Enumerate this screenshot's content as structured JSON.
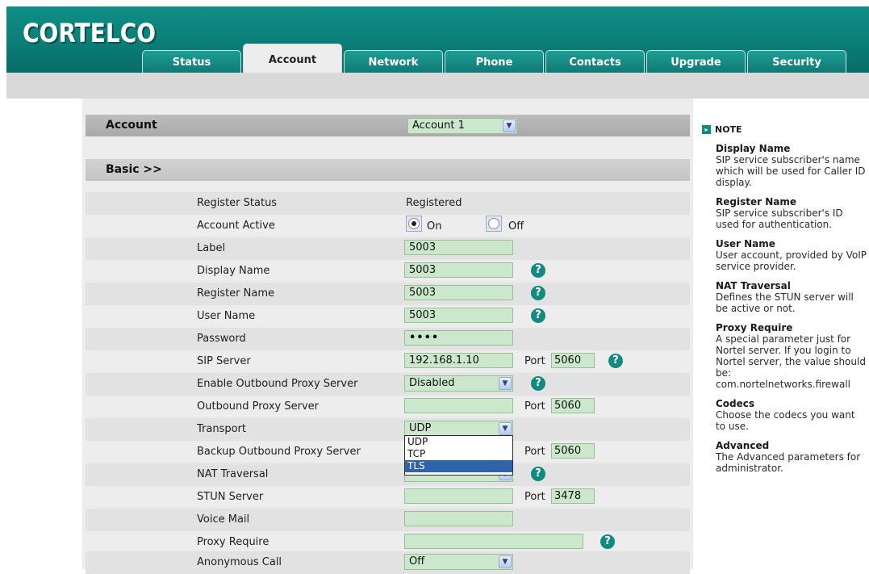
{
  "brand": {
    "logo_text": "CORTELCO"
  },
  "tabs": [
    {
      "label": "Status"
    },
    {
      "label": "Account"
    },
    {
      "label": "Network"
    },
    {
      "label": "Phone"
    },
    {
      "label": "Contacts"
    },
    {
      "label": "Upgrade"
    },
    {
      "label": "Security"
    }
  ],
  "account_bar": {
    "label": "Account",
    "selected": "Account 1"
  },
  "basic_bar": {
    "label": "Basic >>"
  },
  "fields": {
    "register_status": {
      "label": "Register Status",
      "value": "Registered"
    },
    "account_active": {
      "label": "Account Active",
      "on_label": "On",
      "off_label": "Off",
      "selected": "On"
    },
    "label": {
      "label": "Label",
      "value": "5003"
    },
    "display_name": {
      "label": "Display Name",
      "value": "5003"
    },
    "register_name": {
      "label": "Register Name",
      "value": "5003"
    },
    "user_name": {
      "label": "User Name",
      "value": "5003"
    },
    "password": {
      "label": "Password",
      "value": "••••"
    },
    "sip_server": {
      "label": "SIP Server",
      "value": "192.168.1.10",
      "port_label": "Port",
      "port": "5060"
    },
    "enable_outbound_proxy": {
      "label": "Enable Outbound Proxy Server",
      "value": "Disabled"
    },
    "outbound_proxy": {
      "label": "Outbound Proxy Server",
      "value": "",
      "port_label": "Port",
      "port": "5060"
    },
    "transport": {
      "label": "Transport",
      "value": "UDP",
      "options": [
        "UDP",
        "TCP",
        "TLS"
      ],
      "highlighted": "TLS"
    },
    "backup_outbound_proxy": {
      "label": "Backup Outbound Proxy Server",
      "port_label": "Port",
      "port": "5060"
    },
    "nat_traversal": {
      "label": "NAT Traversal"
    },
    "stun_server": {
      "label": "STUN Server",
      "value": "",
      "port_label": "Port",
      "port": "3478"
    },
    "voice_mail": {
      "label": "Voice Mail",
      "value": ""
    },
    "proxy_require": {
      "label": "Proxy Require",
      "value": ""
    },
    "anonymous_call": {
      "label": "Anonymous Call",
      "value": "Off"
    }
  },
  "help_glyph": "?",
  "note": {
    "heading": "NOTE",
    "items": [
      {
        "title": "Display Name",
        "desc": "SIP service subscriber's name which will be used for Caller ID display."
      },
      {
        "title": "Register Name",
        "desc": "SIP service subscriber's ID used for authentication."
      },
      {
        "title": "User Name",
        "desc": "User account, provided by VoIP service provider."
      },
      {
        "title": "NAT Traversal",
        "desc": "Defines the STUN server will be active or not."
      },
      {
        "title": "Proxy Require",
        "desc": "A special parameter just for Nortel server. If you login to Nortel server, the value should be: com.nortelnetworks.firewall"
      },
      {
        "title": "Codecs",
        "desc": "Choose the codecs you want to use."
      },
      {
        "title": "Advanced",
        "desc": "The Advanced parameters for administrator."
      }
    ]
  },
  "colors": {
    "header": "#0b7e77",
    "field_bg": "#cce8cc",
    "help_icon": "#138a81",
    "selection": "#3162ac"
  }
}
